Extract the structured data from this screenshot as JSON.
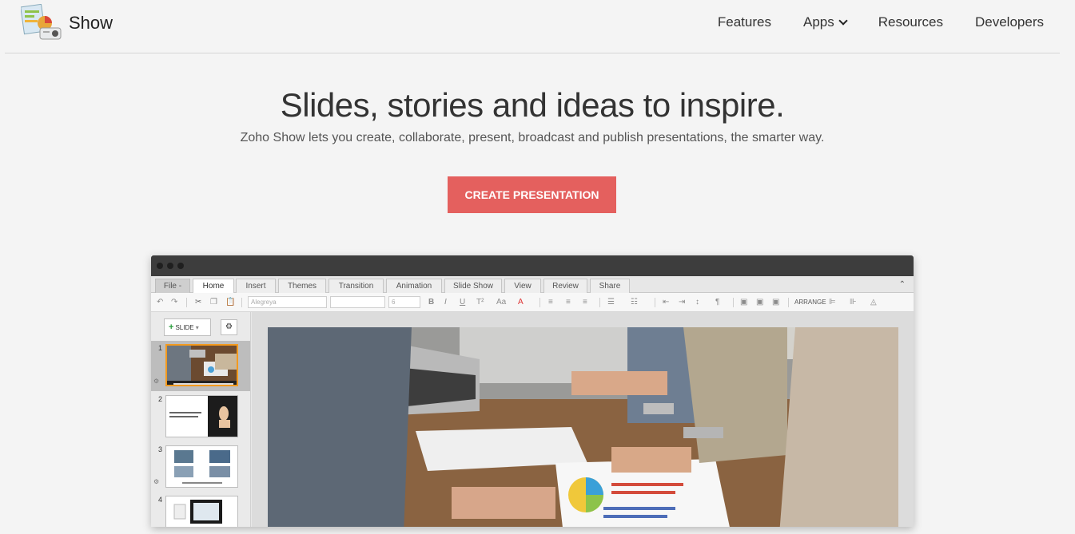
{
  "header": {
    "brand": "Show",
    "nav": [
      {
        "label": "Features"
      },
      {
        "label": "Apps"
      },
      {
        "label": "Resources"
      },
      {
        "label": "Developers"
      }
    ]
  },
  "hero": {
    "title": "Slides, stories and ideas to inspire.",
    "subtitle": "Zoho Show lets you create, collaborate, present, broadcast and publish presentations, the smarter way.",
    "cta_label": "CREATE PRESENTATION"
  },
  "app": {
    "menu_tabs": [
      "File -",
      "Home",
      "Insert",
      "Themes",
      "Transition",
      "Animation",
      "Slide Show",
      "View",
      "Review",
      "Share"
    ],
    "active_tab": "Home",
    "toolbar": {
      "font_family": "Alegreya",
      "font_size": "6",
      "arrange_label": "ARRANGE"
    },
    "sidebar": {
      "slide_button": "SLIDE",
      "slide_numbers": [
        "1",
        "2",
        "3",
        "4"
      ]
    }
  },
  "colors": {
    "cta": "#e4605e",
    "selection": "#f39a1e",
    "titlebar": "#3d3d3d"
  }
}
